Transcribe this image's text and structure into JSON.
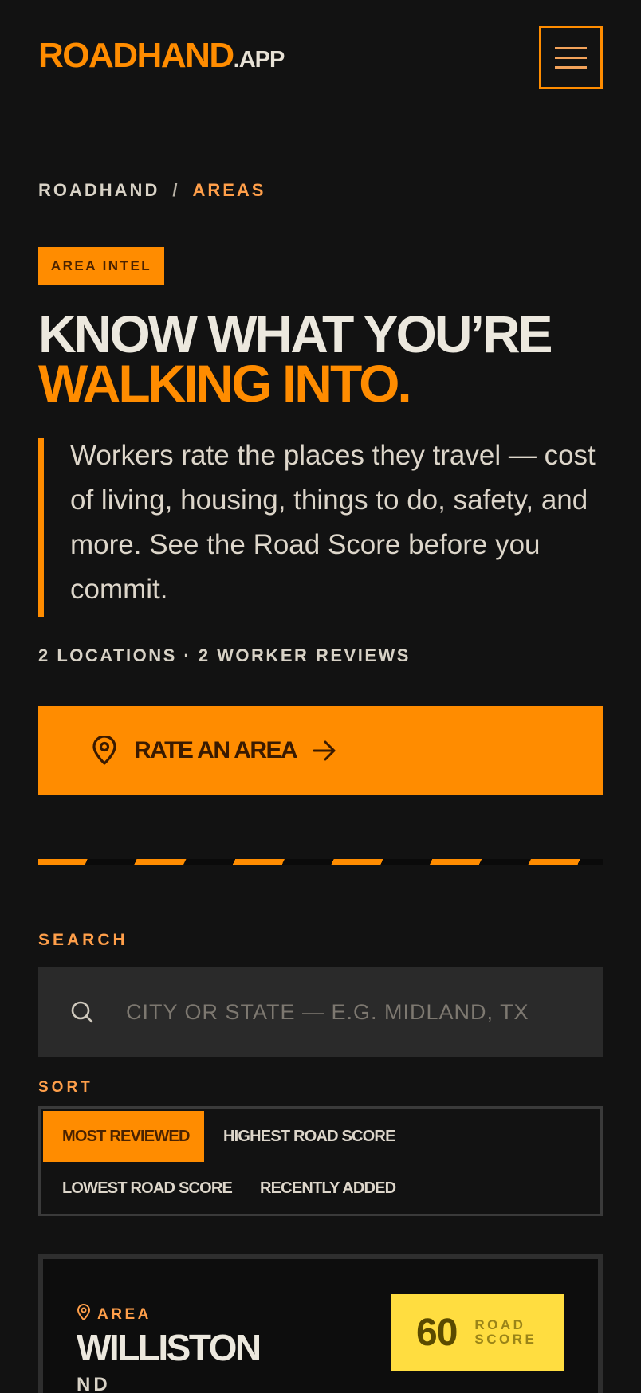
{
  "header": {
    "brand": "ROADHAND",
    "tld": ".APP",
    "menu_icon": "hamburger-icon"
  },
  "breadcrumb": {
    "home": "ROADHAND",
    "separator": "/",
    "current": "AREAS"
  },
  "hero": {
    "tag": "AREA INTEL",
    "headline_line1": "KNOW WHAT YOU’RE",
    "headline_line2": "WALKING INTO.",
    "intro": "Workers rate the places they travel — cost of living, housing, things to do, safety, and more. See the Road Score before you commit.",
    "stats": "2 LOCATIONS · 2 WORKER REVIEWS",
    "cta_label": "RATE AN AREA",
    "cta_icon": "map-pin-icon",
    "cta_arrow_icon": "arrow-right-icon"
  },
  "search": {
    "label": "SEARCH",
    "placeholder": "CITY OR STATE — E.G. MIDLAND, TX",
    "value": "",
    "icon": "search-icon"
  },
  "sort": {
    "label": "SORT",
    "options": [
      {
        "label": "MOST REVIEWED",
        "active": true
      },
      {
        "label": "HIGHEST ROAD SCORE",
        "active": false
      },
      {
        "label": "LOWEST ROAD SCORE",
        "active": false
      },
      {
        "label": "RECENTLY ADDED",
        "active": false
      }
    ]
  },
  "areas": [
    {
      "kind": "AREA",
      "name": "WILLISTON",
      "state": "ND",
      "road_score": "60",
      "score_caption_1": "ROAD",
      "score_caption_2": "SCORE"
    }
  ],
  "colors": {
    "accent": "#ff8c00",
    "background": "#121212",
    "score_badge": "#ffdd40"
  }
}
